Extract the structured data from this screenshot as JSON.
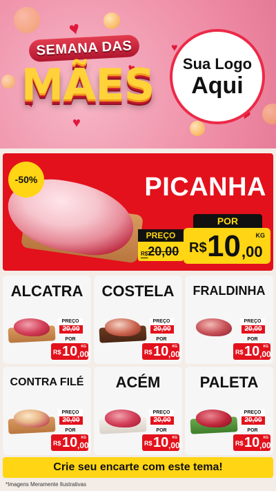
{
  "header": {
    "title_small": "SEMANA DAS",
    "title_big": "MÃES",
    "logo_line1": "Sua Logo",
    "logo_line2": "Aqui"
  },
  "featured": {
    "discount": "-50%",
    "name": "PICANHA",
    "preco_label": "PREÇO",
    "old_currency": "R$",
    "old_price": "20,00",
    "por_label": "POR",
    "currency": "R$",
    "price_int": "10",
    "price_dec": ",00",
    "unit": "KG"
  },
  "products": [
    {
      "name": "ALCATRA",
      "preco_label": "PREÇO",
      "old_price": "20,00",
      "por_label": "POR",
      "currency": "R$",
      "price_int": "10",
      "price_dec": ",00",
      "unit": "KG"
    },
    {
      "name": "COSTELA",
      "preco_label": "PREÇO",
      "old_price": "20,00",
      "por_label": "POR",
      "currency": "R$",
      "price_int": "10",
      "price_dec": ",00",
      "unit": "KG"
    },
    {
      "name": "FRALDINHA",
      "preco_label": "PREÇO",
      "old_price": "20,00",
      "por_label": "POR",
      "currency": "R$",
      "price_int": "10",
      "price_dec": ",00",
      "unit": "KG"
    },
    {
      "name": "CONTRA FILÉ",
      "preco_label": "PREÇO",
      "old_price": "20,00",
      "por_label": "POR",
      "currency": "R$",
      "price_int": "10",
      "price_dec": ",00",
      "unit": "KG"
    },
    {
      "name": "ACÉM",
      "preco_label": "PREÇO",
      "old_price": "20,00",
      "por_label": "POR",
      "currency": "R$",
      "price_int": "10",
      "price_dec": ",00",
      "unit": "KG"
    },
    {
      "name": "PALETA",
      "preco_label": "PREÇO",
      "old_price": "20,00",
      "por_label": "POR",
      "currency": "R$",
      "price_int": "10",
      "price_dec": ",00",
      "unit": "KG"
    }
  ],
  "footer": {
    "cta": "Crie seu encarte com este tema!",
    "disclaimer": "*Imagens Meramente Ilustrativas"
  },
  "colors": {
    "accent_red": "#e3111c",
    "accent_yellow": "#ffd514"
  }
}
